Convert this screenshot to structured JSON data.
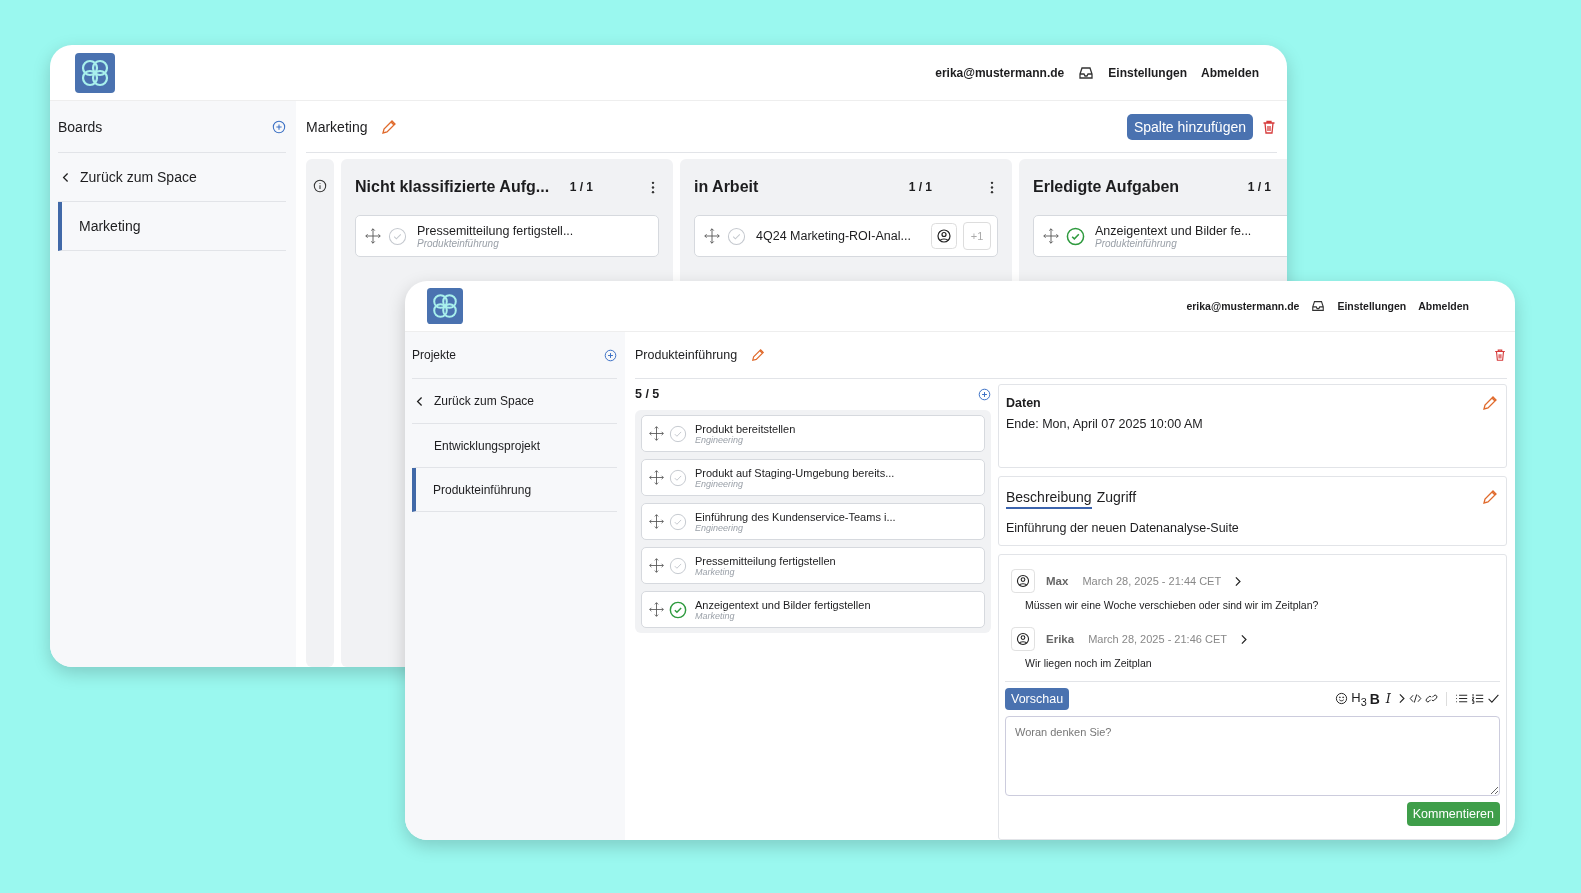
{
  "back_window": {
    "header": {
      "email": "erika@mustermann.de",
      "nav": [
        "Einstellungen",
        "Abmelden"
      ]
    },
    "sidebar": {
      "title": "Boards",
      "back_link": "Zurück zum Space",
      "items": [
        {
          "label": "Marketing",
          "selected": true
        }
      ]
    },
    "board": {
      "title": "Marketing",
      "add_column_button": "Spalte hinzufügen",
      "columns": [
        {
          "title": "Nicht klassifizierte Aufg...",
          "count": "1 / 1",
          "cards": [
            {
              "title": "Pressemitteilung fertigstell...",
              "project": "Produkteinführung",
              "done": false
            }
          ]
        },
        {
          "title": "in Arbeit",
          "count": "1 / 1",
          "cards": [
            {
              "title": "4Q24 Marketing-ROI-Anal...",
              "done": false,
              "assignee": true,
              "extra": "+1"
            }
          ]
        },
        {
          "title": "Erledigte Aufgaben",
          "count": "1 / 1",
          "cards": [
            {
              "title": "Anzeigentext und Bilder fe...",
              "project": "Produkteinführung",
              "done": true
            }
          ]
        }
      ]
    }
  },
  "front_window": {
    "header": {
      "email": "erika@mustermann.de",
      "nav": [
        "Einstellungen",
        "Abmelden"
      ]
    },
    "sidebar": {
      "title": "Projekte",
      "back_link": "Zurück zum Space",
      "items": [
        {
          "label": "Entwicklungsprojekt",
          "selected": false
        },
        {
          "label": "Produkteinführung",
          "selected": true
        }
      ]
    },
    "project": {
      "title": "Produkteinführung",
      "count": "5 / 5",
      "tasks": [
        {
          "title": "Produkt bereitstellen",
          "tag": "Engineering",
          "done": false
        },
        {
          "title": "Produkt auf Staging-Umgebung bereits...",
          "tag": "Engineering",
          "done": false
        },
        {
          "title": "Einführung des Kundenservice-Teams i...",
          "tag": "Engineering",
          "done": false
        },
        {
          "title": "Pressemitteilung fertigstellen",
          "tag": "Marketing",
          "done": false
        },
        {
          "title": "Anzeigentext und Bilder fertigstellen",
          "tag": "Marketing",
          "done": true
        }
      ]
    },
    "details": {
      "heading": "Daten",
      "end": "Ende: Mon, April 07 2025 10:00 AM"
    },
    "tabs": [
      {
        "label": "Beschreibung",
        "selected": true
      },
      {
        "label": "Zugriff",
        "selected": false
      }
    ],
    "description": "Einführung der neuen Datenanalyse-Suite",
    "comments": [
      {
        "author": "Max",
        "time": "March 28, 2025 - 21:44 CET",
        "text": "Müssen wir eine Woche verschieben oder sind wir im Zeitplan?"
      },
      {
        "author": "Erika",
        "time": "March 28, 2025 - 21:46 CET",
        "text": "Wir liegen noch im Zeitplan"
      }
    ],
    "editor": {
      "preview_button": "Vorschau",
      "toolbar": [
        {
          "kind": "emoji"
        },
        {
          "kind": "heading",
          "label": "H$_{3}$"
        },
        {
          "kind": "bold",
          "label": "B"
        },
        {
          "kind": "italic",
          "label": "I"
        },
        {
          "kind": "quote"
        },
        {
          "kind": "code"
        },
        {
          "kind": "link"
        },
        {
          "kind": "divider"
        },
        {
          "kind": "bullets"
        },
        {
          "kind": "numbers"
        },
        {
          "kind": "check"
        }
      ],
      "placeholder": "Woran denken Sie?",
      "submit_button": "Kommentieren"
    }
  }
}
